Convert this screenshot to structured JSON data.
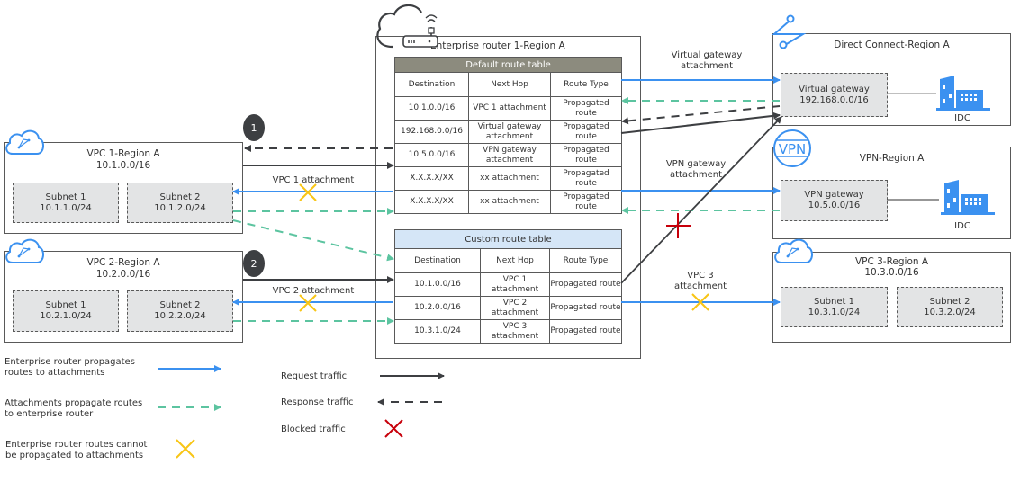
{
  "router": {
    "title": "Enterprise router 1-Region A",
    "default_table": {
      "title": "Default route table",
      "columns": [
        "Destination",
        "Next Hop",
        "Route Type"
      ],
      "rows": [
        [
          "10.1.0.0/16",
          "VPC 1 attachment",
          "Propagated route"
        ],
        [
          "192.168.0.0/16",
          "Virtual gateway attachment",
          "Propagated route"
        ],
        [
          "10.5.0.0/16",
          "VPN gateway attachment",
          "Propagated route"
        ],
        [
          "X.X.X.X/XX",
          "xx attachment",
          "Propagated route"
        ],
        [
          "X.X.X.X/XX",
          "xx attachment",
          "Propagated route"
        ]
      ]
    },
    "custom_table": {
      "title": "Custom route table",
      "columns": [
        "Destination",
        "Next Hop",
        "Route Type"
      ],
      "rows": [
        [
          "10.1.0.0/16",
          "VPC 1 attachment",
          "Propagated route"
        ],
        [
          "10.2.0.0/16",
          "VPC 2 attachment",
          "Propagated route"
        ],
        [
          "10.3.1.0/24",
          "VPC 3 attachment",
          "Propagated route"
        ]
      ]
    }
  },
  "vpc1": {
    "name": "VPC 1-Region A",
    "cidr": "10.1.0.0/16",
    "subnets": [
      {
        "name": "Subnet 1",
        "cidr": "10.1.1.0/24"
      },
      {
        "name": "Subnet 2",
        "cidr": "10.1.2.0/24"
      }
    ],
    "attachment_label": "VPC 1 attachment",
    "badge": "1"
  },
  "vpc2": {
    "name": "VPC 2-Region A",
    "cidr": "10.2.0.0/16",
    "subnets": [
      {
        "name": "Subnet 1",
        "cidr": "10.2.1.0/24"
      },
      {
        "name": "Subnet 2",
        "cidr": "10.2.2.0/24"
      }
    ],
    "attachment_label": "VPC 2 attachment",
    "badge": "2"
  },
  "vpc3": {
    "name": "VPC 3-Region A",
    "cidr": "10.3.0.0/16",
    "subnets": [
      {
        "name": "Subnet 1",
        "cidr": "10.3.1.0/24"
      },
      {
        "name": "Subnet 2",
        "cidr": "10.3.2.0/24"
      }
    ],
    "attachment_label_1": "VPC 3",
    "attachment_label_2": "attachment"
  },
  "direct_connect": {
    "name": "Direct Connect-Region A",
    "gateway_name": "Virtual gateway",
    "gateway_cidr": "192.168.0.0/16",
    "idc_label": "IDC",
    "attachment_label_1": "Virtual gateway",
    "attachment_label_2": "attachment"
  },
  "vpn": {
    "name": "VPN-Region A",
    "gateway_name": "VPN gateway",
    "gateway_cidr": "10.5.0.0/16",
    "idc_label": "IDC",
    "icon_text": "VPN",
    "attachment_label_1": "VPN gateway",
    "attachment_label_2": "attachment"
  },
  "legend": {
    "propagate_to_attachments": [
      "Enterprise router propagates",
      "routes to attachments"
    ],
    "propagate_to_router": [
      "Attachments propagate routes",
      "to enterprise router"
    ],
    "cannot_propagate": [
      "Enterprise router routes cannot",
      "be propagated to attachments"
    ],
    "request": "Request traffic",
    "response": "Response traffic",
    "blocked": "Blocked traffic"
  },
  "colors": {
    "blue": "#3b91f0",
    "green_dashed": "#5cc4a0",
    "dark": "#3d3f42",
    "blocked_red": "#c7000b",
    "cannot_yellow": "#f8c514",
    "default_header": "#8c8b7e",
    "custom_header": "#d5e6f7",
    "subnet_fill": "#e3e4e5"
  }
}
